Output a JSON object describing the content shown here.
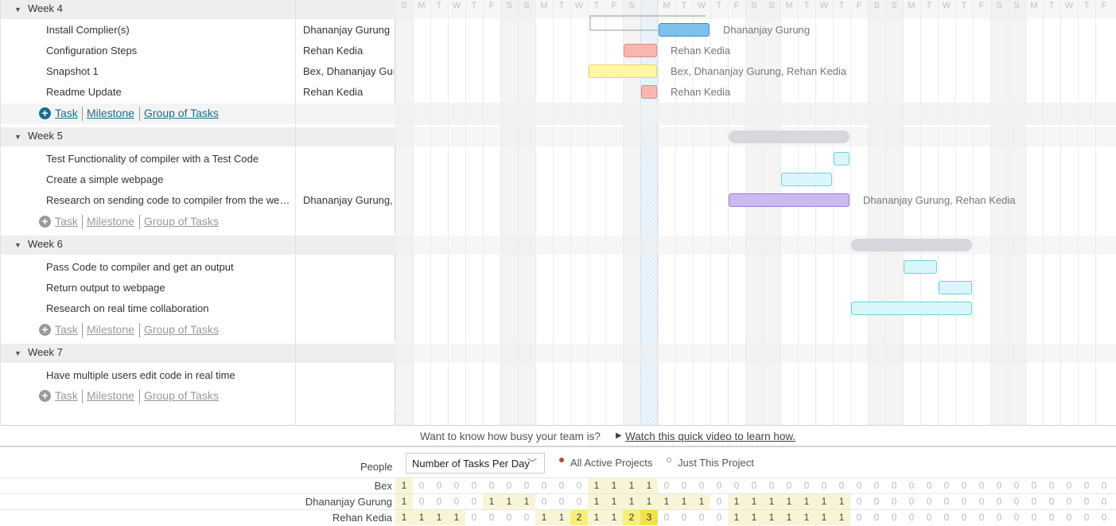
{
  "days": [
    "S",
    "M",
    "T",
    "W",
    "T",
    "F",
    "S",
    "S",
    "M",
    "T",
    "W",
    "T",
    "F",
    "S",
    "S",
    "M",
    "T",
    "W",
    "T",
    "F",
    "S",
    "S",
    "M",
    "T",
    "W",
    "T",
    "F",
    "S",
    "S",
    "M",
    "T",
    "W",
    "T",
    "F",
    "S",
    "S",
    "M",
    "T",
    "W",
    "T",
    "F"
  ],
  "today_index": 14,
  "add_row": {
    "task": "Task",
    "milestone": "Milestone",
    "group": "Group of Tasks",
    "plus": "+"
  },
  "groups": [
    {
      "name": "Week 4",
      "collapse_icon": "▼",
      "active": true,
      "tasks": [
        {
          "name": "Install Complier(s)",
          "assignee": "Dhananjay Gurung",
          "bar": {
            "start": 15,
            "end": 18,
            "color": "blue"
          },
          "bar_label": "Dhananjay Gurung"
        },
        {
          "name": "Configuration Steps",
          "assignee": "Rehan Kedia",
          "bar": {
            "start": 13,
            "end": 15,
            "color": "red"
          },
          "bar_label": "Rehan Kedia"
        },
        {
          "name": "Snapshot 1",
          "assignee": "Bex, Dhananjay Gurung",
          "bar": {
            "start": 11,
            "end": 15,
            "color": "yellow"
          },
          "bar_label": "Bex, Dhananjay Gurung, Rehan Kedia"
        },
        {
          "name": "Readme Update",
          "assignee": "Rehan Kedia",
          "bar": {
            "start": 14,
            "end": 15,
            "color": "red"
          },
          "bar_label": "Rehan Kedia"
        }
      ]
    },
    {
      "name": "Week 5",
      "collapse_icon": "▼",
      "active": false,
      "group_bar": {
        "start": 19,
        "end": 26
      },
      "tasks": [
        {
          "name": "Test Functionality of compiler with a Test Code",
          "assignee": "",
          "bar": {
            "start": 25,
            "end": 26,
            "color": "cyan"
          },
          "bar_label": ""
        },
        {
          "name": "Create a simple webpage",
          "assignee": "",
          "bar": {
            "start": 22,
            "end": 25,
            "color": "cyan"
          },
          "bar_label": ""
        },
        {
          "name": "Research on sending code to compiler from the webpage",
          "assignee": "Dhananjay Gurung, Rehan Kedia",
          "bar": {
            "start": 19,
            "end": 26,
            "color": "purple"
          },
          "bar_label": "Dhananjay Gurung, Rehan Kedia"
        }
      ]
    },
    {
      "name": "Week 6",
      "collapse_icon": "▼",
      "active": false,
      "group_bar": {
        "start": 26,
        "end": 33
      },
      "tasks": [
        {
          "name": "Pass Code to compiler and get an output",
          "assignee": "",
          "bar": {
            "start": 29,
            "end": 31,
            "color": "cyan"
          },
          "bar_label": ""
        },
        {
          "name": "Return output to webpage",
          "assignee": "",
          "bar": {
            "start": 31,
            "end": 33,
            "color": "cyan"
          },
          "bar_label": ""
        },
        {
          "name": "Research on real time collaboration",
          "assignee": "",
          "bar": {
            "start": 26,
            "end": 33,
            "color": "cyan"
          },
          "bar_label": ""
        }
      ]
    },
    {
      "name": "Week 7",
      "collapse_icon": "▼",
      "active": false,
      "tasks": [
        {
          "name": "Have multiple users edit code in real time",
          "assignee": "",
          "bar": null,
          "bar_label": ""
        }
      ]
    }
  ],
  "promo": {
    "question": "Want to know how busy your team is?",
    "play_icon": "▶",
    "link": "Watch this quick video to learn how."
  },
  "workload": {
    "people_label": "People",
    "metric": "Number of Tasks Per Day",
    "metric_chevron": "﹀",
    "option_all": "All Active Projects",
    "option_this": "Just This Project",
    "rows": [
      {
        "name": "Bex",
        "values": [
          1,
          0,
          0,
          0,
          0,
          0,
          0,
          0,
          0,
          0,
          0,
          1,
          1,
          1,
          1,
          0,
          0,
          0,
          0,
          0,
          0,
          0,
          0,
          0,
          0,
          0,
          0,
          0,
          0,
          0,
          0,
          0,
          0,
          0,
          0,
          0,
          0,
          0,
          0,
          0,
          0
        ]
      },
      {
        "name": "Dhananjay Gurung",
        "values": [
          1,
          0,
          0,
          0,
          0,
          1,
          1,
          1,
          0,
          0,
          0,
          1,
          1,
          1,
          1,
          1,
          1,
          1,
          0,
          1,
          1,
          1,
          1,
          1,
          1,
          1,
          0,
          0,
          0,
          0,
          0,
          0,
          0,
          0,
          0,
          0,
          0,
          0,
          0,
          0,
          0
        ]
      },
      {
        "name": "Rehan Kedia",
        "values": [
          1,
          1,
          1,
          1,
          0,
          0,
          0,
          0,
          1,
          1,
          2,
          1,
          1,
          2,
          3,
          0,
          0,
          0,
          0,
          1,
          1,
          1,
          1,
          1,
          1,
          1,
          0,
          0,
          0,
          0,
          0,
          0,
          0,
          0,
          0,
          0,
          0,
          0,
          0,
          0,
          0
        ]
      }
    ]
  }
}
